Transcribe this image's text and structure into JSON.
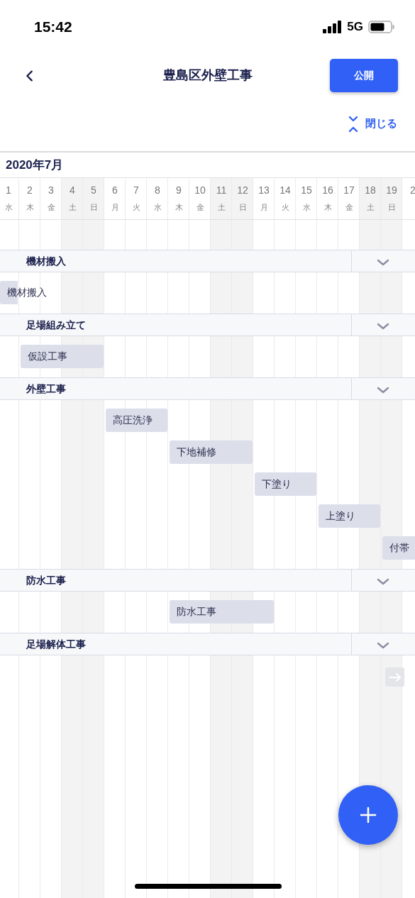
{
  "status_bar": {
    "time": "15:42",
    "network": "5G"
  },
  "header": {
    "title": "豊島区外壁工事",
    "publish_button": "公開",
    "collapse_link": "閉じる"
  },
  "calendar": {
    "month": "2020年7月",
    "days": [
      {
        "day": "1",
        "weekday": "水",
        "weekend": false
      },
      {
        "day": "2",
        "weekday": "木",
        "weekend": false
      },
      {
        "day": "3",
        "weekday": "金",
        "weekend": false
      },
      {
        "day": "4",
        "weekday": "土",
        "weekend": true
      },
      {
        "day": "5",
        "weekday": "日",
        "weekend": true
      },
      {
        "day": "6",
        "weekday": "月",
        "weekend": false
      },
      {
        "day": "7",
        "weekday": "火",
        "weekend": false
      },
      {
        "day": "8",
        "weekday": "水",
        "weekend": false
      },
      {
        "day": "9",
        "weekday": "木",
        "weekend": false
      },
      {
        "day": "10",
        "weekday": "金",
        "weekend": false
      },
      {
        "day": "11",
        "weekday": "土",
        "weekend": true
      },
      {
        "day": "12",
        "weekday": "日",
        "weekend": true
      },
      {
        "day": "13",
        "weekday": "月",
        "weekend": false
      },
      {
        "day": "14",
        "weekday": "火",
        "weekend": false
      },
      {
        "day": "15",
        "weekday": "水",
        "weekend": false
      },
      {
        "day": "16",
        "weekday": "木",
        "weekend": false
      },
      {
        "day": "17",
        "weekday": "金",
        "weekend": false
      },
      {
        "day": "18",
        "weekday": "土",
        "weekend": true
      },
      {
        "day": "19",
        "weekday": "日",
        "weekend": true
      },
      {
        "day": "2",
        "weekend": false
      }
    ]
  },
  "sections": [
    {
      "name": "機材搬入",
      "tasks": [
        {
          "label": "機材搬入"
        }
      ]
    },
    {
      "name": "足場組み立て",
      "tasks": [
        {
          "label": "仮設工事"
        }
      ]
    },
    {
      "name": "外壁工事",
      "tasks": [
        {
          "label": "高圧洗浄"
        },
        {
          "label": "下地補修"
        },
        {
          "label": "下塗り"
        },
        {
          "label": "上塗り"
        },
        {
          "label": "付帯"
        }
      ]
    },
    {
      "name": "防水工事",
      "tasks": [
        {
          "label": "防水工事"
        }
      ]
    },
    {
      "name": "足場解体工事"
    }
  ]
}
